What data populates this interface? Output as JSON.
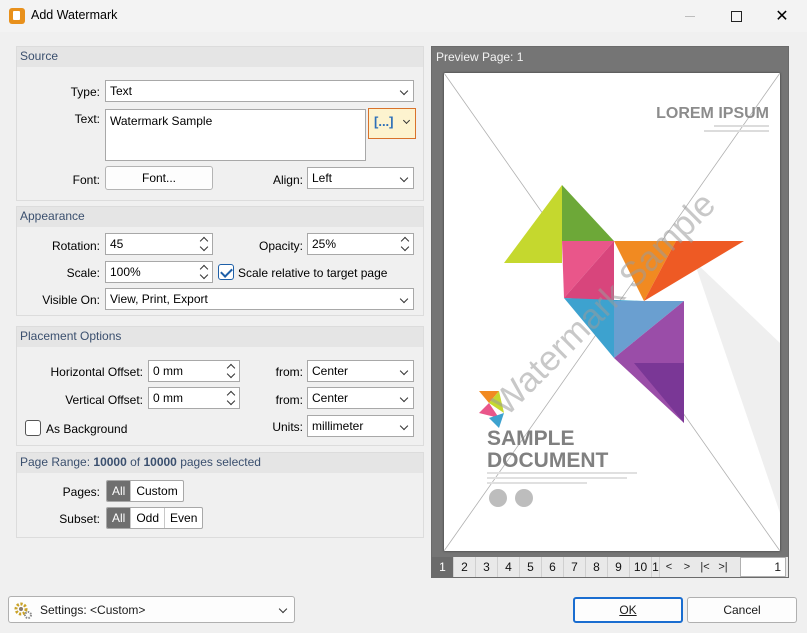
{
  "window": {
    "title": "Add Watermark"
  },
  "source": {
    "header": "Source",
    "type_label": "Type:",
    "type_value": "Text",
    "text_label": "Text:",
    "text_value": "Watermark Sample",
    "macro_button_label": "[...]",
    "font_label": "Font:",
    "font_button": "Font...",
    "align_label": "Align:",
    "align_value": "Left"
  },
  "appearance": {
    "header": "Appearance",
    "rotation_label": "Rotation:",
    "rotation_value": "45",
    "opacity_label": "Opacity:",
    "opacity_value": "25%",
    "scale_label": "Scale:",
    "scale_value": "100%",
    "scale_relative_label": "Scale relative to target page",
    "scale_relative_checked": true,
    "visible_on_label": "Visible On:",
    "visible_on_value": "View, Print, Export"
  },
  "placement": {
    "header": "Placement Options",
    "h_offset_label": "Horizontal Offset:",
    "h_offset_value": "0 mm",
    "h_from_label": "from:",
    "h_from_value": "Center",
    "v_offset_label": "Vertical Offset:",
    "v_offset_value": "0 mm",
    "v_from_label": "from:",
    "v_from_value": "Center",
    "as_background_label": "As Background",
    "as_background_checked": false,
    "units_label": "Units:",
    "units_value": "millimeter"
  },
  "page_range": {
    "header_prefix": "Page Range:",
    "selected": "10000",
    "of": "of",
    "total": "10000",
    "suffix": "pages selected",
    "pages_label": "Pages:",
    "pages_options": [
      "All",
      "Custom"
    ],
    "subset_label": "Subset:",
    "subset_options": [
      "All",
      "Odd",
      "Even"
    ]
  },
  "preview": {
    "title": "Preview Page: 1",
    "doc_heading": "LOREM IPSUM",
    "doc_title_line1": "SAMPLE",
    "doc_title_line2": "DOCUMENT",
    "watermark_text": "Watermark Sample",
    "pages": [
      "1",
      "2",
      "3",
      "4",
      "5",
      "6",
      "7",
      "8",
      "9",
      "10",
      "1"
    ],
    "current_page": "1"
  },
  "footer": {
    "settings_label": "Settings:",
    "settings_value": "<Custom>",
    "ok_label": "OK",
    "cancel_label": "Cancel"
  },
  "colors": {
    "accent": "#1a6dd0",
    "group_header_text": "#3a4f6e",
    "watermark": "#9a9a9a"
  }
}
